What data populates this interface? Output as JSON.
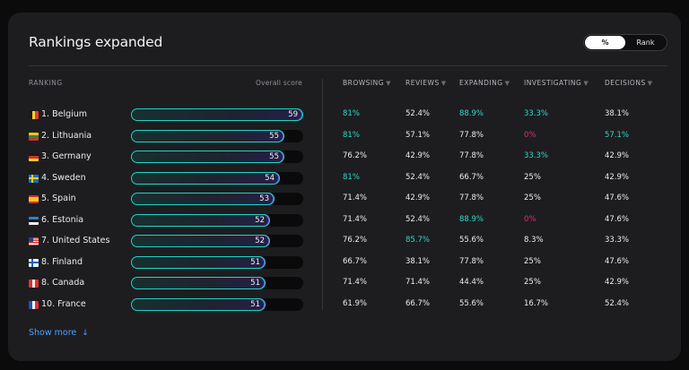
{
  "title": "Rankings expanded",
  "toggle": {
    "options": [
      "%",
      "Rank"
    ],
    "active": "%"
  },
  "headers": {
    "ranking": "RANKING",
    "overall": "Overall score",
    "columns": [
      "BROWSING",
      "REVIEWS",
      "EXPANDING",
      "INVESTIGATING",
      "DECISIONS"
    ]
  },
  "colors": {
    "accent_cyan": "#2ed8c3",
    "accent_pink": "#e0297a",
    "text": "#ececee",
    "link": "#4ea0ff"
  },
  "rows": [
    {
      "name": "1. Belgium",
      "flag": "belgium-flag-icon",
      "score": 59,
      "browsing": "81%",
      "reviews": "52.4%",
      "expanding": "88.9%",
      "investigating": "33.3%",
      "decisions": "38.1%",
      "hl": {
        "browsing": "cyan",
        "expanding": "cyan",
        "investigating": "cyan"
      }
    },
    {
      "name": "2. Lithuania",
      "flag": "lithuania-flag-icon",
      "score": 55,
      "browsing": "81%",
      "reviews": "57.1%",
      "expanding": "77.8%",
      "investigating": "0%",
      "decisions": "57.1%",
      "hl": {
        "browsing": "cyan",
        "investigating": "pink",
        "decisions": "cyan"
      }
    },
    {
      "name": "3. Germany",
      "flag": "germany-flag-icon",
      "score": 55,
      "browsing": "76.2%",
      "reviews": "42.9%",
      "expanding": "77.8%",
      "investigating": "33.3%",
      "decisions": "42.9%",
      "hl": {
        "investigating": "cyan"
      }
    },
    {
      "name": "4. Sweden",
      "flag": "sweden-flag-icon",
      "score": 54,
      "browsing": "81%",
      "reviews": "52.4%",
      "expanding": "66.7%",
      "investigating": "25%",
      "decisions": "42.9%",
      "hl": {
        "browsing": "cyan"
      }
    },
    {
      "name": "5. Spain",
      "flag": "spain-flag-icon",
      "score": 53,
      "browsing": "71.4%",
      "reviews": "42.9%",
      "expanding": "77.8%",
      "investigating": "25%",
      "decisions": "47.6%",
      "hl": {}
    },
    {
      "name": "6. Estonia",
      "flag": "estonia-flag-icon",
      "score": 52,
      "browsing": "71.4%",
      "reviews": "52.4%",
      "expanding": "88.9%",
      "investigating": "0%",
      "decisions": "47.6%",
      "hl": {
        "expanding": "cyan",
        "investigating": "pink"
      }
    },
    {
      "name": "7. United States",
      "flag": "usa-flag-icon",
      "score": 52,
      "browsing": "76.2%",
      "reviews": "85.7%",
      "expanding": "55.6%",
      "investigating": "8.3%",
      "decisions": "33.3%",
      "hl": {
        "reviews": "cyan"
      }
    },
    {
      "name": "8. Finland",
      "flag": "finland-flag-icon",
      "score": 51,
      "browsing": "66.7%",
      "reviews": "38.1%",
      "expanding": "77.8%",
      "investigating": "25%",
      "decisions": "47.6%",
      "hl": {}
    },
    {
      "name": "8. Canada",
      "flag": "canada-flag-icon",
      "score": 51,
      "browsing": "71.4%",
      "reviews": "71.4%",
      "expanding": "44.4%",
      "investigating": "25%",
      "decisions": "42.9%",
      "hl": {}
    },
    {
      "name": "10. France",
      "flag": "france-flag-icon",
      "score": 51,
      "browsing": "61.9%",
      "reviews": "66.7%",
      "expanding": "55.6%",
      "investigating": "16.7%",
      "decisions": "52.4%",
      "hl": {}
    }
  ],
  "show_more": "Show more",
  "show_more_icon": "arrow-down-icon"
}
